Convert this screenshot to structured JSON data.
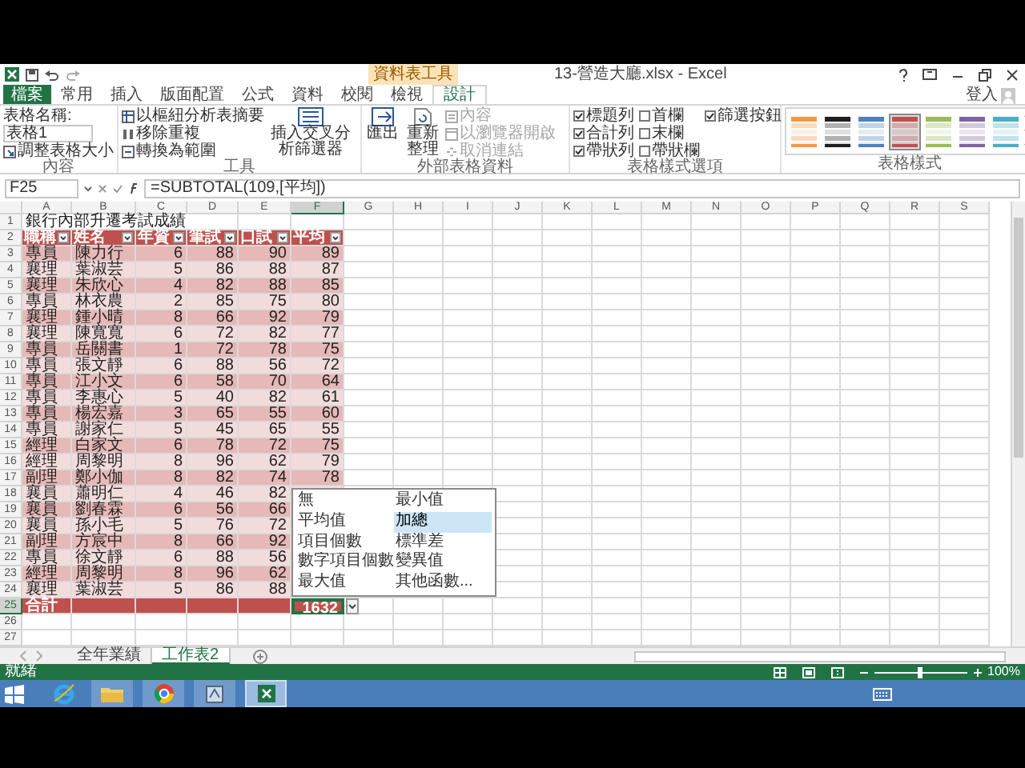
{
  "window": {
    "title": "13-營造大廳.xlsx - Excel",
    "context_label": "資料表工具",
    "sign_in": "登入"
  },
  "ribbon_tabs": [
    {
      "label": "檔案",
      "kind": "file",
      "selected": false
    },
    {
      "label": "常用",
      "kind": "tab",
      "selected": false
    },
    {
      "label": "插入",
      "kind": "tab",
      "selected": false
    },
    {
      "label": "版面配置",
      "kind": "tab",
      "selected": false
    },
    {
      "label": "公式",
      "kind": "tab",
      "selected": false
    },
    {
      "label": "資料",
      "kind": "tab",
      "selected": false
    },
    {
      "label": "校閱",
      "kind": "tab",
      "selected": false
    },
    {
      "label": "檢視",
      "kind": "tab",
      "selected": false
    },
    {
      "label": "設計",
      "kind": "tab",
      "selected": true
    }
  ],
  "properties": {
    "label": "內容",
    "name_label": "表格名稱:",
    "name_value": "表格1",
    "resize": "調整表格大小"
  },
  "tools": {
    "label": "工具",
    "items": [
      "以樞紐分析表摘要",
      "移除重複",
      "轉換為範圍"
    ],
    "slicer": "插入交叉分析篩選器"
  },
  "external": {
    "label": "外部表格資料",
    "export": "匯出",
    "refresh": "重新整理",
    "items": [
      {
        "label": "內容",
        "disabled": true
      },
      {
        "label": "以瀏覽器開啟",
        "disabled": true
      },
      {
        "label": "取消連結",
        "disabled": true
      }
    ]
  },
  "style_options": {
    "label": "表格樣式選項",
    "columns": [
      [
        {
          "label": "標題列",
          "checked": true
        },
        {
          "label": "合計列",
          "checked": true
        },
        {
          "label": "帶狀列",
          "checked": true
        }
      ],
      [
        {
          "label": "首欄",
          "checked": false
        },
        {
          "label": "末欄",
          "checked": false
        },
        {
          "label": "帶狀欄",
          "checked": false
        }
      ],
      [
        {
          "label": "篩選按鈕",
          "checked": true
        }
      ]
    ]
  },
  "table_styles": {
    "label": "表格樣式",
    "styles": [
      {
        "color": "#f79646",
        "selected": false
      },
      {
        "color": "#1f1f1f",
        "selected": false
      },
      {
        "color": "#4f81bd",
        "selected": false
      },
      {
        "color": "#c0504d",
        "selected": true
      },
      {
        "color": "#9bbb59",
        "selected": false
      },
      {
        "color": "#8064a2",
        "selected": false
      },
      {
        "color": "#4bacc6",
        "selected": false
      }
    ]
  },
  "formula_bar": {
    "name_box": "F25",
    "formula": "=SUBTOTAL(109,[平均])"
  },
  "sheet": {
    "columns": [
      {
        "label": "A",
        "selected": false
      },
      {
        "label": "B",
        "selected": false
      },
      {
        "label": "C",
        "selected": false
      },
      {
        "label": "D",
        "selected": false
      },
      {
        "label": "E",
        "selected": false
      },
      {
        "label": "F",
        "selected": true
      },
      {
        "label": "G",
        "selected": false
      },
      {
        "label": "H",
        "selected": false
      },
      {
        "label": "I",
        "selected": false
      },
      {
        "label": "J",
        "selected": false
      },
      {
        "label": "K",
        "selected": false
      },
      {
        "label": "L",
        "selected": false
      },
      {
        "label": "M",
        "selected": false
      },
      {
        "label": "N",
        "selected": false
      },
      {
        "label": "O",
        "selected": false
      },
      {
        "label": "P",
        "selected": false
      },
      {
        "label": "Q",
        "selected": false
      },
      {
        "label": "R",
        "selected": false
      },
      {
        "label": "S",
        "selected": false
      }
    ],
    "row_numbers": [
      {
        "label": "1",
        "selected": false
      },
      {
        "label": "2",
        "selected": false
      },
      {
        "label": "3",
        "selected": false
      },
      {
        "label": "4",
        "selected": false
      },
      {
        "label": "5",
        "selected": false
      },
      {
        "label": "6",
        "selected": false
      },
      {
        "label": "7",
        "selected": false
      },
      {
        "label": "8",
        "selected": false
      },
      {
        "label": "9",
        "selected": false
      },
      {
        "label": "10",
        "selected": false
      },
      {
        "label": "11",
        "selected": false
      },
      {
        "label": "12",
        "selected": false
      },
      {
        "label": "13",
        "selected": false
      },
      {
        "label": "14",
        "selected": false
      },
      {
        "label": "15",
        "selected": false
      },
      {
        "label": "16",
        "selected": false
      },
      {
        "label": "17",
        "selected": false
      },
      {
        "label": "18",
        "selected": false
      },
      {
        "label": "19",
        "selected": false
      },
      {
        "label": "20",
        "selected": false
      },
      {
        "label": "21",
        "selected": false
      },
      {
        "label": "22",
        "selected": false
      },
      {
        "label": "23",
        "selected": false
      },
      {
        "label": "24",
        "selected": false
      },
      {
        "label": "25",
        "selected": true
      },
      {
        "label": "26",
        "selected": false
      },
      {
        "label": "27",
        "selected": false
      }
    ],
    "title": "銀行內部升遷考試成績",
    "headers": [
      "職稱",
      "姓名",
      "年資",
      "筆試",
      "口試",
      "平均"
    ],
    "rows": [
      [
        "專員",
        "陳力行",
        "6",
        "88",
        "90",
        "89"
      ],
      [
        "襄理",
        "葉淑芸",
        "5",
        "86",
        "88",
        "87"
      ],
      [
        "襄理",
        "朱欣心",
        "4",
        "82",
        "88",
        "85"
      ],
      [
        "專員",
        "林衣農",
        "2",
        "85",
        "75",
        "80"
      ],
      [
        "襄理",
        "鍾小晴",
        "8",
        "66",
        "92",
        "79"
      ],
      [
        "襄理",
        "陳寬寬",
        "6",
        "72",
        "82",
        "77"
      ],
      [
        "專員",
        "岳關書",
        "1",
        "72",
        "78",
        "75"
      ],
      [
        "專員",
        "張文靜",
        "6",
        "88",
        "56",
        "72"
      ],
      [
        "專員",
        "江小文",
        "6",
        "58",
        "70",
        "64"
      ],
      [
        "專員",
        "李惠心",
        "5",
        "40",
        "82",
        "61"
      ],
      [
        "專員",
        "楊宏嘉",
        "3",
        "65",
        "55",
        "60"
      ],
      [
        "專員",
        "謝家仁",
        "5",
        "45",
        "65",
        "55"
      ],
      [
        "經理",
        "白家文",
        "6",
        "78",
        "72",
        "75"
      ],
      [
        "經理",
        "周黎明",
        "8",
        "96",
        "62",
        "79"
      ],
      [
        "副理",
        "鄭小伽",
        "8",
        "82",
        "74",
        "78"
      ],
      [
        "襄員",
        "蕭明仁",
        "4",
        "46",
        "82"
      ],
      [
        "襄員",
        "劉春霖",
        "6",
        "56",
        "66"
      ],
      [
        "襄員",
        "孫小毛",
        "5",
        "76",
        "72"
      ],
      [
        "副理",
        "方宸中",
        "8",
        "66",
        "92"
      ],
      [
        "專員",
        "徐文靜",
        "6",
        "88",
        "56"
      ],
      [
        "經理",
        "周黎明",
        "8",
        "96",
        "62"
      ],
      [
        "襄理",
        "葉淑芸",
        "5",
        "86",
        "88"
      ]
    ],
    "total_label": "合計",
    "total_value": "1632"
  },
  "dropdown": [
    {
      "label": "無",
      "selected": false
    },
    {
      "label": "平均值",
      "selected": false
    },
    {
      "label": "項目個數",
      "selected": false
    },
    {
      "label": "數字項目個數",
      "selected": false
    },
    {
      "label": "最大值",
      "selected": false
    },
    {
      "label": "最小值",
      "selected": false
    },
    {
      "label": "加總",
      "selected": true
    },
    {
      "label": "標準差",
      "selected": false
    },
    {
      "label": "變異值",
      "selected": false
    },
    {
      "label": "其他函數...",
      "selected": false
    }
  ],
  "sheet_tabs": [
    {
      "label": "全年業績",
      "selected": false
    },
    {
      "label": "工作表2",
      "selected": true
    }
  ],
  "status": {
    "text": "就緒",
    "zoom": "100%",
    "zoom_level": {
      "level": 0.5
    }
  }
}
